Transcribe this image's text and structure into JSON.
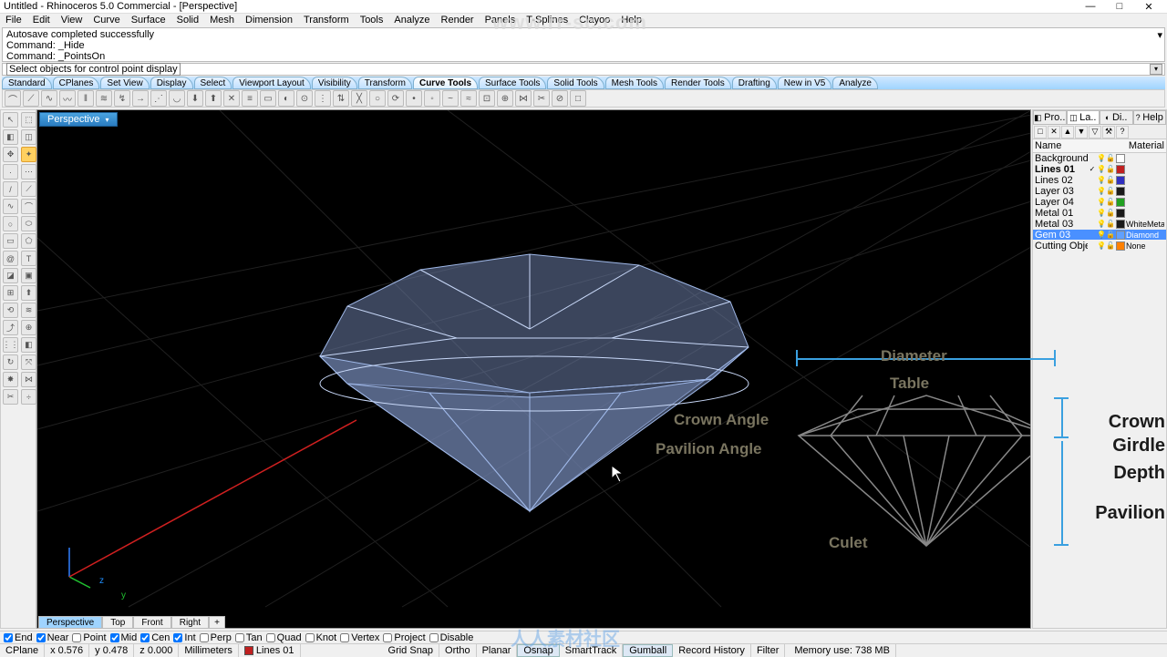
{
  "title": "Untitled - Rhinoceros 5.0 Commercial - [Perspective]",
  "menu": [
    "File",
    "Edit",
    "View",
    "Curve",
    "Surface",
    "Solid",
    "Mesh",
    "Dimension",
    "Transform",
    "Tools",
    "Analyze",
    "Render",
    "Panels",
    "T-Splines",
    "Clayoo",
    "Help"
  ],
  "cmd_history": [
    "Autosave completed successfully",
    "Command: _Hide",
    "Command: _PointsOn"
  ],
  "cmd_prompt": "Select objects for control point display",
  "tool_tabs": [
    "Standard",
    "CPlanes",
    "Set View",
    "Display",
    "Select",
    "Viewport Layout",
    "Visibility",
    "Transform",
    "Curve Tools",
    "Surface Tools",
    "Solid Tools",
    "Mesh Tools",
    "Render Tools",
    "Drafting",
    "New in V5",
    "Analyze"
  ],
  "tool_tab_active": 8,
  "viewport_label": "Perspective",
  "right_tabs": [
    "Pro..",
    "La..",
    "Di..",
    "Help"
  ],
  "right_tab_active": 1,
  "layer_header": {
    "name": "Name",
    "material": "Material"
  },
  "layers": [
    {
      "name": "Background",
      "color": "#ffffff",
      "mat": ""
    },
    {
      "name": "Lines 01",
      "color": "#c02020",
      "mat": "",
      "bold": true,
      "check": true
    },
    {
      "name": "Lines 02",
      "color": "#3030c0",
      "mat": ""
    },
    {
      "name": "Layer 03",
      "color": "#1a1a1a",
      "mat": ""
    },
    {
      "name": "Layer 04",
      "color": "#20a020",
      "mat": ""
    },
    {
      "name": "Metal 01",
      "color": "#1a1a1a",
      "mat": ""
    },
    {
      "name": "Metal 03",
      "color": "#1a1a1a",
      "mat": "WhiteMeta"
    },
    {
      "name": "Gem 03",
      "color": "#60a0ff",
      "mat": "Diamond",
      "selected": true
    },
    {
      "name": "Cutting Obje..",
      "color": "#ff8000",
      "mat": "None"
    }
  ],
  "view_tabs": [
    "Perspective",
    "Top",
    "Front",
    "Right"
  ],
  "view_tab_active": 0,
  "osnaps": [
    {
      "label": "End",
      "checked": true
    },
    {
      "label": "Near",
      "checked": true
    },
    {
      "label": "Point",
      "checked": false
    },
    {
      "label": "Mid",
      "checked": true
    },
    {
      "label": "Cen",
      "checked": true
    },
    {
      "label": "Int",
      "checked": true
    },
    {
      "label": "Perp",
      "checked": false
    },
    {
      "label": "Tan",
      "checked": false
    },
    {
      "label": "Quad",
      "checked": false
    },
    {
      "label": "Knot",
      "checked": false
    },
    {
      "label": "Vertex",
      "checked": false
    },
    {
      "label": "Project",
      "checked": false
    },
    {
      "label": "Disable",
      "checked": false
    }
  ],
  "status": {
    "cplane": "CPlane",
    "x": "x 0.576",
    "y": "y 0.478",
    "z": "z 0.000",
    "units": "Millimeters",
    "layer": "Lines 01",
    "toggles": [
      "Grid Snap",
      "Ortho",
      "Planar",
      "Osnap",
      "SmartTrack",
      "Gumball",
      "Record History",
      "Filter"
    ],
    "toggles_active": [
      3,
      5
    ],
    "memory": "Memory use: 738 MB"
  },
  "annotations": {
    "diameter": "Diameter",
    "table": "Table",
    "crown_angle": "Crown Angle",
    "pavilion_angle": "Pavilion Angle",
    "culet": "Culet",
    "crown": "Crown",
    "girdle": "Girdle",
    "depth": "Depth",
    "pavilion": "Pavilion"
  },
  "url_watermark": "www.rr-sc.com",
  "brand_watermark": "人人素材社区"
}
